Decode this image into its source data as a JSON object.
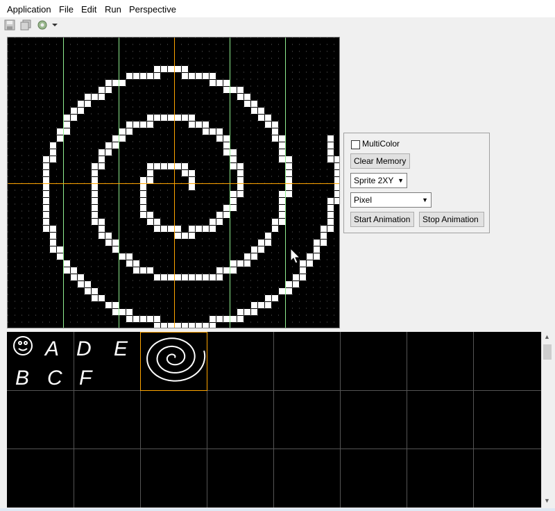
{
  "menu": [
    "Application",
    "File",
    "Edit",
    "Run",
    "Perspective"
  ],
  "toolbar": {
    "icons": [
      "save-icon",
      "save-all-icon",
      "run-icon",
      "run-dropdown-icon"
    ]
  },
  "controls": {
    "multicolor_label": "MultiColor",
    "multicolor_checked": false,
    "clear_memory_label": "Clear Memory",
    "sprite_mode_value": "Sprite 2XY",
    "draw_mode_value": "Pixel",
    "start_animation_label": "Start Animation",
    "stop_animation_label": "Stop Animation"
  },
  "gallery": {
    "sprite_names": [
      "A",
      "D",
      "E",
      "B",
      "C",
      "F"
    ],
    "selected_index": 1
  },
  "colors": {
    "canvas_bg": "#000000",
    "pixel_on": "#ffffff",
    "center_guide": "#ffa500",
    "grid_guide": "#90ee90",
    "selection": "#ffa500"
  }
}
